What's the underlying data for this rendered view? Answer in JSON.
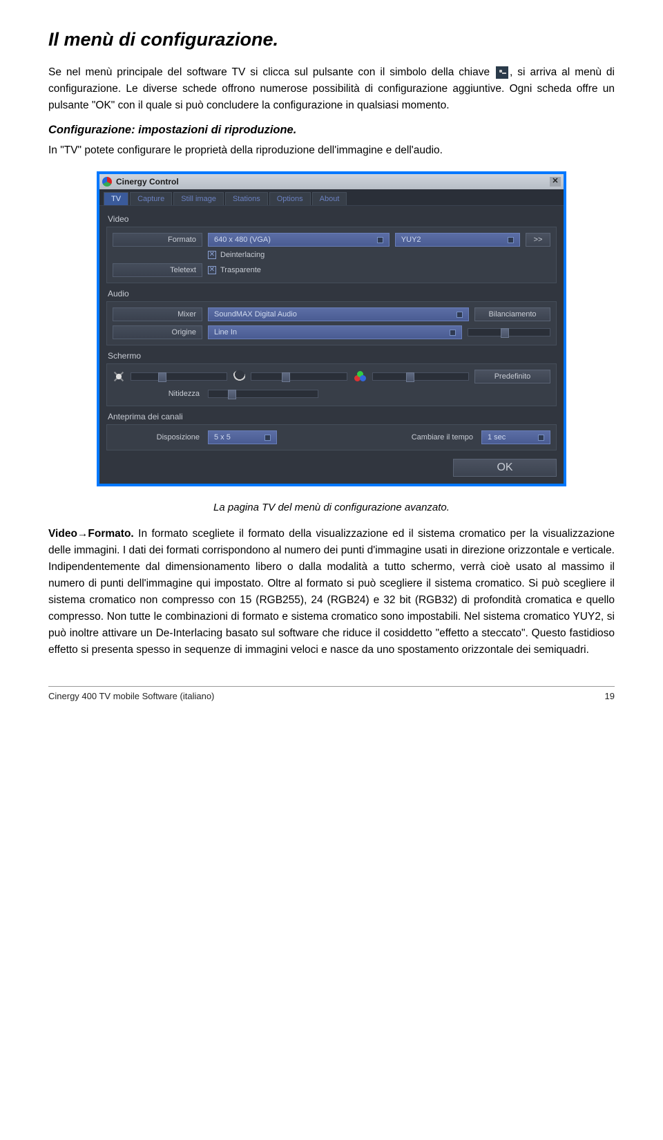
{
  "doc": {
    "title": "Il menù di configurazione.",
    "p1a": "Se nel menù principale del software TV si clicca sul pulsante con il simbolo della chiave ",
    "p1b": ", si arriva al menù di configurazione. Le diverse schede offrono numerose possibilità di configurazione aggiuntive. Ogni scheda offre un pulsante \"OK\" con il quale si può concludere la configurazione in qualsiasi momento.",
    "sub1": "Configurazione: impostazioni di riproduzione.",
    "p2": "In \"TV\" potete configurare le proprietà della riproduzione dell'immagine e dell'audio.",
    "caption": "La pagina TV del menù di configurazione avanzato.",
    "p3_lead": "Video→Formato.",
    "p3": " In formato scegliete il formato della visualizzazione ed il sistema cromatico per la visualizzazione delle immagini. I dati dei formati corrispondono al numero dei punti d'immagine usati in direzione orizzontale e verticale. Indipendentemente dal dimensionamento libero o dalla modalità a tutto schermo, verrà cioè usato al massimo il numero di punti dell'immagine qui impostato. Oltre al formato si può scegliere il sistema cromatico. Si può scegliere il sistema cromatico non compresso con 15 (RGB255), 24 (RGB24) e 32 bit (RGB32) di profondità cromatica e quello compresso. Non tutte le combinazioni di formato e sistema cromatico sono impostabili. Nel sistema cromatico YUY2, si può inoltre attivare un De-Interlacing basato sul software che riduce il cosiddetto \"effetto a steccato\". Questo fastidioso effetto si presenta spesso in sequenze di immagini veloci e nasce da uno spostamento orizzontale dei semiquadri.",
    "footer_left": "Cinergy 400 TV mobile Software (italiano)",
    "footer_right": "19"
  },
  "app": {
    "window_title": "Cinergy Control",
    "close_glyph": "✕",
    "tabs": [
      "TV",
      "Capture",
      "Still image",
      "Stations",
      "Options",
      "About"
    ],
    "active_tab": 0,
    "video": {
      "section": "Video",
      "formato_label": "Formato",
      "formato_value": "640 x 480 (VGA)",
      "color_value": "YUY2",
      "more_btn": ">>",
      "deinterlacing": "Deinterlacing",
      "teletext_label": "Teletext",
      "trasparente": "Trasparente"
    },
    "audio": {
      "section": "Audio",
      "mixer_label": "Mixer",
      "mixer_value": "SoundMAX Digital Audio",
      "balance_btn": "Bilanciamento",
      "origine_label": "Origine",
      "origine_value": "Line In"
    },
    "schermo": {
      "section": "Schermo",
      "predef_btn": "Predefinito",
      "nitidezza_label": "Nitidezza"
    },
    "anteprima": {
      "section": "Anteprima dei canali",
      "disposizione_label": "Disposizione",
      "disposizione_value": "5 x 5",
      "cambiare_label": "Cambiare il tempo",
      "cambiare_value": "1 sec"
    },
    "ok_btn": "OK"
  }
}
